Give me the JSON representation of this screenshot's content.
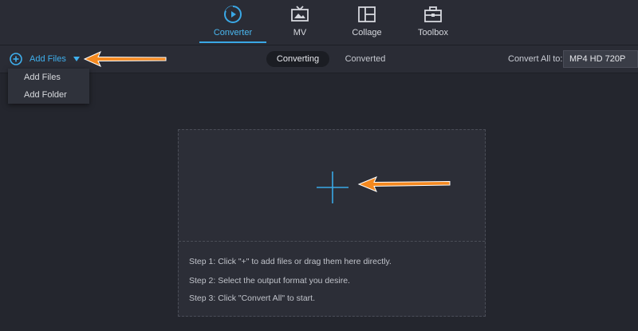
{
  "nav": {
    "tabs": [
      {
        "label": "Converter",
        "icon": "converter-icon",
        "active": true
      },
      {
        "label": "MV",
        "icon": "mv-icon",
        "active": false
      },
      {
        "label": "Collage",
        "icon": "collage-icon",
        "active": false
      },
      {
        "label": "Toolbox",
        "icon": "toolbox-icon",
        "active": false
      }
    ]
  },
  "toolbar": {
    "add_files_label": "Add Files",
    "segments": [
      "Converting",
      "Converted"
    ],
    "convert_all_label": "Convert All to:",
    "format_value": "MP4 HD 720P"
  },
  "dropdown": {
    "items": [
      "Add Files",
      "Add Folder"
    ]
  },
  "dropzone": {
    "steps": [
      "Step 1: Click \"+\" to add files or drag them here directly.",
      "Step 2: Select the output format you desire.",
      "Step 3: Click \"Convert All\" to start."
    ]
  },
  "colors": {
    "accent": "#3aa8e6",
    "annotation_arrow": "#f5891f",
    "background": "#24262e"
  }
}
